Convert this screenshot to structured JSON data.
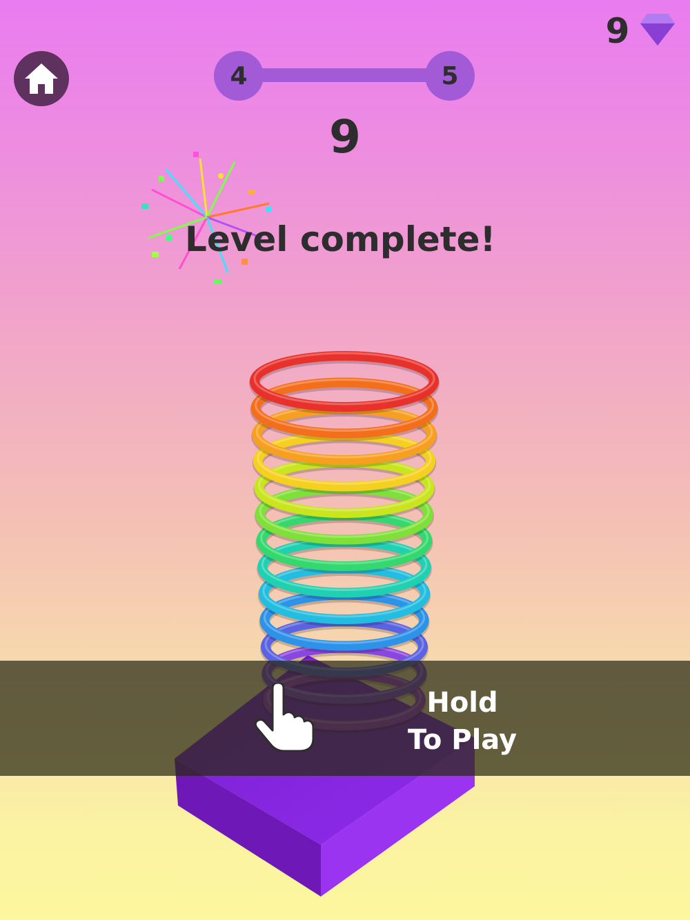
{
  "header": {
    "home_icon": "home-icon",
    "gems": {
      "count": "9",
      "icon": "diamond-icon",
      "color": "#9b51e0"
    }
  },
  "level_progress": {
    "current": "4",
    "next": "5",
    "color": "#a25ad6"
  },
  "score": "9",
  "message": "Level complete!",
  "prompt": {
    "line1": "Hold",
    "line2": "To Play",
    "icon": "tap-hand-icon"
  },
  "tower": {
    "ring_colors": [
      "#e8312a",
      "#f36f1c",
      "#f7a01f",
      "#f6d020",
      "#c9e51e",
      "#7fe03a",
      "#35d86f",
      "#1fd0b3",
      "#22bde0",
      "#2d93e8",
      "#5a64e2",
      "#8a46e0",
      "#a53fd9"
    ],
    "platform_color": "#8a24e0"
  },
  "colors": {
    "text": "#2d2d2d",
    "home_bg": "#5e315e"
  }
}
